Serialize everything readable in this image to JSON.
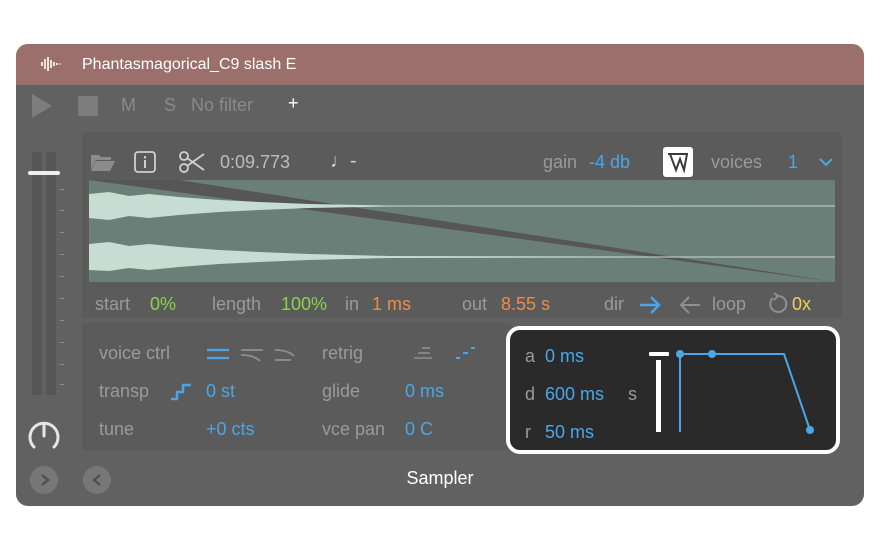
{
  "window": {
    "title": "Phantasmagorical_C9 slash E"
  },
  "transport": {
    "mute_label": "M",
    "solo_label": "S",
    "filter_label": "No filter",
    "add_label": "+"
  },
  "clip": {
    "duration": "0:09.773",
    "tempo_glyph": "♩-"
  },
  "gain": {
    "label": "gain",
    "value": "-4 db"
  },
  "voices": {
    "label": "voices",
    "value": "1"
  },
  "params": {
    "start_label": "start",
    "start_value": "0%",
    "length_label": "length",
    "length_value": "100%",
    "in_label": "in",
    "in_value": "1 ms",
    "out_label": "out",
    "out_value": "8.55 s",
    "dir_label": "dir",
    "loop_label": "loop",
    "loop_value": "0x"
  },
  "voice_section": {
    "voice_ctrl_label": "voice ctrl",
    "retrig_label": "retrig",
    "transp_label": "transp",
    "transp_value": "0 st",
    "glide_label": "glide",
    "glide_value": "0 ms",
    "tune_label": "tune",
    "tune_value": "+0 cts",
    "vce_pan_label": "vce pan",
    "vce_pan_value": "0 C"
  },
  "envelope": {
    "a_label": "a",
    "a_value": "0 ms",
    "d_label": "d",
    "d_value": "600 ms",
    "s_label": "s",
    "r_label": "r",
    "r_value": "50 ms",
    "sustain_level": 0.95
  },
  "footer": {
    "device_name": "Sampler"
  },
  "colors": {
    "accent": "#4aa6e8",
    "title_bar": "#9b6f6c",
    "green": "#8ed04f",
    "orange": "#f08a4b",
    "yellow": "#ecd25a"
  }
}
